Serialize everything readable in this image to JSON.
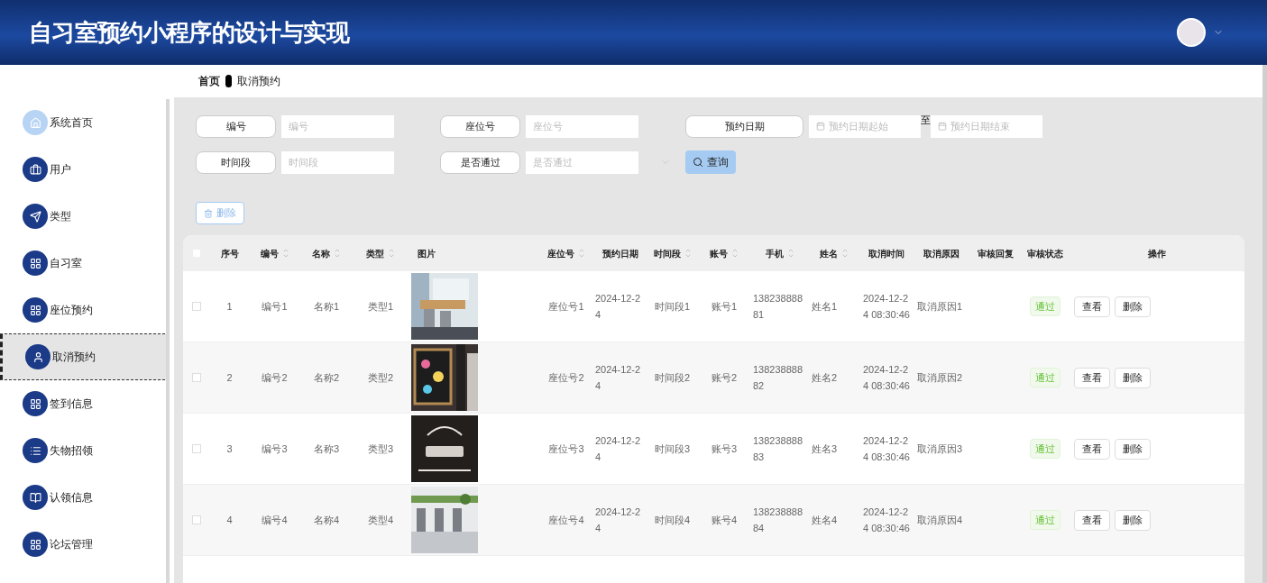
{
  "header": {
    "title": "自习室预约小程序的设计与实现"
  },
  "breadcrumb": [
    "首页",
    "取消预约"
  ],
  "sidebar": {
    "items": [
      {
        "label": "系统首页",
        "selected": false
      },
      {
        "label": "用户",
        "selected": false
      },
      {
        "label": "类型",
        "selected": false
      },
      {
        "label": "自习室",
        "selected": false
      },
      {
        "label": "座位预约",
        "selected": false
      },
      {
        "label": "取消预约",
        "selected": true
      },
      {
        "label": "签到信息",
        "selected": false
      },
      {
        "label": "失物招领",
        "selected": false
      },
      {
        "label": "认领信息",
        "selected": false
      },
      {
        "label": "论坛管理",
        "selected": false
      }
    ]
  },
  "filters": [
    [
      {
        "kind": "text",
        "label": "编号",
        "placeholder": "编号"
      },
      {
        "kind": "text",
        "label": "座位号",
        "placeholder": "座位号"
      },
      {
        "kind": "daterange",
        "label": "预约日期",
        "placeholder": "预约日期起始",
        "separator": "至",
        "placeholder_end": "预约日期结束"
      }
    ],
    [
      {
        "kind": "text",
        "label": "时间段",
        "placeholder": "时间段"
      },
      {
        "kind": "select",
        "label": "是否通过",
        "placeholder": "是否通过"
      },
      {
        "kind": "button",
        "label": "查询"
      }
    ]
  ],
  "delete_button": "删除",
  "table": {
    "select_all_checked": false,
    "columns": [
      {
        "label": "序号",
        "sortable": false
      },
      {
        "label": "编号",
        "sortable": true
      },
      {
        "label": "名称",
        "sortable": true
      },
      {
        "label": "类型",
        "sortable": true
      },
      {
        "label": "图片",
        "sortable": false
      },
      {
        "label": "座位号",
        "sortable": true
      },
      {
        "label": "预约日期",
        "sortable": false
      },
      {
        "label": "时间段",
        "sortable": true
      },
      {
        "label": "账号",
        "sortable": true
      },
      {
        "label": "手机",
        "sortable": true
      },
      {
        "label": "姓名",
        "sortable": true
      },
      {
        "label": "取消时间",
        "sortable": false
      },
      {
        "label": "取消原因",
        "sortable": false
      },
      {
        "label": "审核回复",
        "sortable": false
      },
      {
        "label": "审核状态",
        "sortable": false
      },
      {
        "label": "操作",
        "sortable": false
      }
    ],
    "rows": [
      {
        "checked": false,
        "cells": [
          "1",
          "编号1",
          "名称1",
          "类型1",
          "",
          "座位号1",
          "2024-12-24",
          "时间段1",
          "账号1",
          "13823888881",
          "姓名1",
          "2024-12-24 08:30:46",
          "取消原因1",
          "",
          "通过"
        ],
        "actions": [
          "查看",
          "删除"
        ]
      },
      {
        "checked": false,
        "cells": [
          "2",
          "编号2",
          "名称2",
          "类型2",
          "",
          "座位号2",
          "2024-12-24",
          "时间段2",
          "账号2",
          "13823888882",
          "姓名2",
          "2024-12-24 08:30:46",
          "取消原因2",
          "",
          "通过"
        ],
        "actions": [
          "查看",
          "删除"
        ]
      },
      {
        "checked": false,
        "cells": [
          "3",
          "编号3",
          "名称3",
          "类型3",
          "",
          "座位号3",
          "2024-12-24",
          "时间段3",
          "账号3",
          "13823888883",
          "姓名3",
          "2024-12-24 08:30:46",
          "取消原因3",
          "",
          "通过"
        ],
        "actions": [
          "查看",
          "删除"
        ]
      },
      {
        "checked": false,
        "cells": [
          "4",
          "编号4",
          "名称4",
          "类型4",
          "",
          "座位号4",
          "2024-12-24",
          "时间段4",
          "账号4",
          "13823888884",
          "姓名4",
          "2024-12-24 08:30:46",
          "取消原因4",
          "",
          "通过"
        ],
        "actions": [
          "查看",
          "删除"
        ]
      }
    ]
  }
}
